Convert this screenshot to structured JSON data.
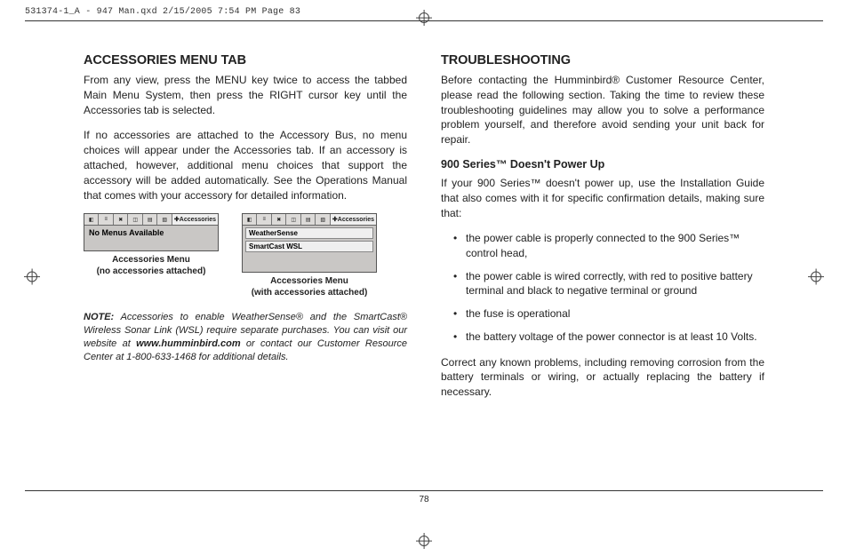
{
  "print_header": "531374-1_A - 947 Man.qxd  2/15/2005  7:54 PM  Page 83",
  "page_number": "78",
  "left": {
    "heading": "ACCESSORIES MENU TAB",
    "p1": "From any view, press the MENU key twice to access the tabbed Main Menu System, then press the RIGHT cursor key until the Accessories tab is selected.",
    "p2": "If no accessories are attached to the Accessory Bus, no menu choices will appear under the Accessories tab. If an accessory is attached, however, additional menu choices that support the accessory will be added automatically. See the Operations Manual that comes with your accessory for detailed information.",
    "fig1": {
      "tab_label": "Accessories",
      "body": "No Menus Available",
      "caption_l1": "Accessories Menu",
      "caption_l2": "(no accessories attached)"
    },
    "fig2": {
      "tab_label": "Accessories",
      "row1": "WeatherSense",
      "row2": "SmartCast WSL",
      "caption_l1": "Accessories Menu",
      "caption_l2": "(with accessories attached)"
    },
    "note_label": "NOTE:",
    "note_text_1": " Accessories to enable WeatherSense® and the SmartCast® Wireless Sonar Link (WSL) require separate purchases. You can visit our website at ",
    "note_url": "www.humminbird.com",
    "note_text_2": " or contact our Customer Resource Center at 1-800-633-1468 for additional details."
  },
  "right": {
    "heading": "TROUBLESHOOTING",
    "p1": "Before contacting the Humminbird® Customer Resource Center, please read the following section. Taking the time to review these troubleshooting guidelines may allow you to solve a performance problem yourself, and therefore avoid sending your unit back for repair.",
    "sub1": "900 Series™ Doesn't Power Up",
    "p2": "If your 900 Series™ doesn't power up, use the Installation Guide that also comes with it for specific confirmation details, making sure that:",
    "bullets": {
      "b1": "the power cable is properly connected to the 900 Series™ control head,",
      "b2": "the power cable is wired correctly, with red to positive battery terminal and black to negative terminal or ground",
      "b3": "the fuse is operational",
      "b4": "the battery voltage of the power connector is at least 10 Volts."
    },
    "p3": "Correct any known problems, including removing corrosion from the battery terminals or wiring, or actually replacing the battery if necessary."
  }
}
